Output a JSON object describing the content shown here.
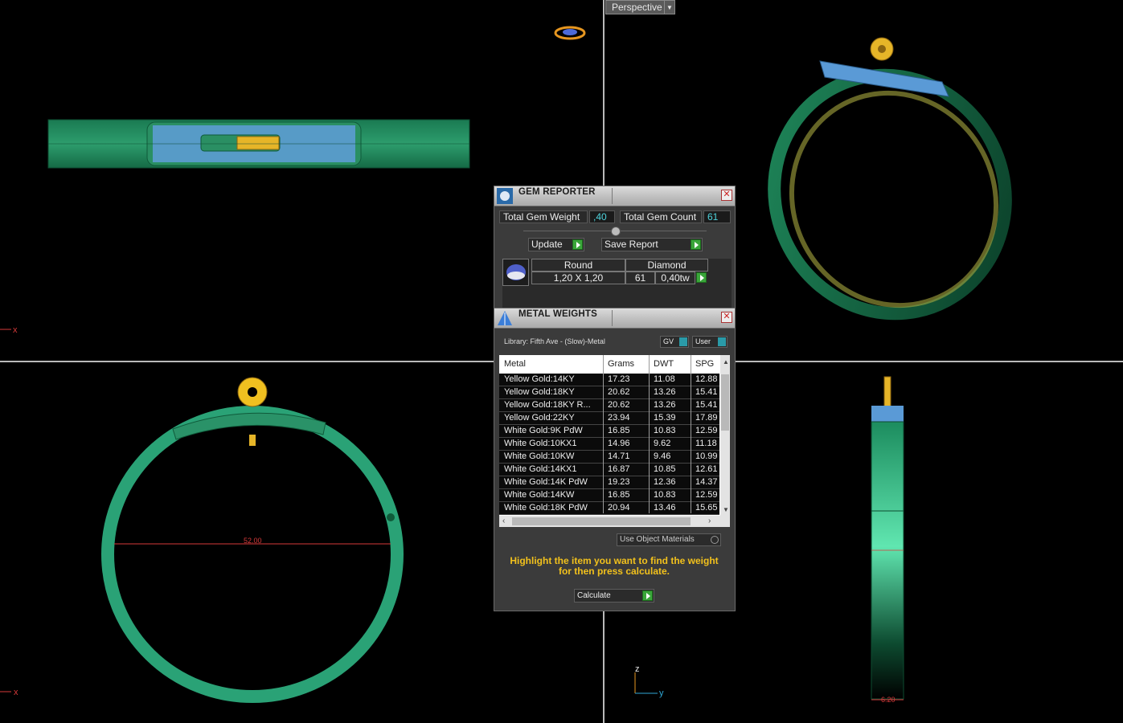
{
  "viewport": {
    "mode": "Perspective",
    "axis_x": "x",
    "axis_z": "z",
    "axis_y": "y",
    "dim_diameter": "52.00",
    "dim_width": "6.20"
  },
  "gem_reporter": {
    "title": "GEM REPORTER",
    "total_gem_weight_label": "Total Gem Weight",
    "total_gem_weight": ",40",
    "total_gem_count_label": "Total Gem Count",
    "total_gem_count": "61",
    "update_label": "Update",
    "save_report_label": "Save Report",
    "gem": {
      "shape": "Round",
      "type": "Diamond",
      "size": "1,20 X 1,20",
      "count": "61",
      "tw": "0,40tw"
    }
  },
  "metal_weights": {
    "title": "METAL WEIGHTS",
    "library": "Library: Fifth Ave - (Slow)-Metal",
    "gv_label": "GV",
    "user_label": "User",
    "columns": [
      "Metal",
      "Grams",
      "DWT",
      "SPG"
    ],
    "rows": [
      [
        "Yellow Gold:14KY",
        "17.23",
        "11.08",
        "12.88"
      ],
      [
        "Yellow Gold:18KY",
        "20.62",
        "13.26",
        "15.41"
      ],
      [
        "Yellow Gold:18KY R...",
        "20.62",
        "13.26",
        "15.41"
      ],
      [
        "Yellow Gold:22KY",
        "23.94",
        "15.39",
        "17.89"
      ],
      [
        "White Gold:9K PdW",
        "16.85",
        "10.83",
        "12.59"
      ],
      [
        "White Gold:10KX1",
        "14.96",
        "9.62",
        "11.18"
      ],
      [
        "White Gold:10KW",
        "14.71",
        "9.46",
        "10.99"
      ],
      [
        "White Gold:14KX1",
        "16.87",
        "10.85",
        "12.61"
      ],
      [
        "White Gold:14K PdW",
        "19.23",
        "12.36",
        "14.37"
      ],
      [
        "White Gold:14KW",
        "16.85",
        "10.83",
        "12.59"
      ],
      [
        "White Gold:18K PdW",
        "20.94",
        "13.46",
        "15.65"
      ]
    ],
    "use_object_materials": "Use Object Materials",
    "hint": "Highlight the item you want to find the weight for then press calculate.",
    "calculate_label": "Calculate"
  }
}
